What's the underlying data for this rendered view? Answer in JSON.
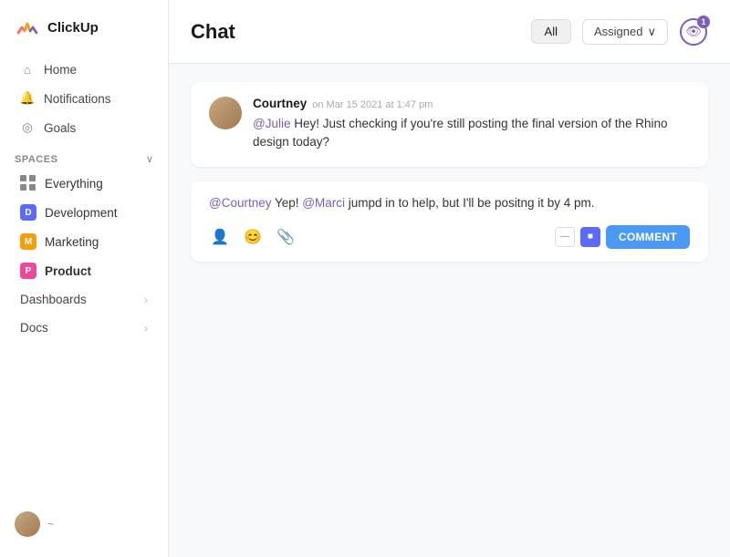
{
  "app": {
    "name": "ClickUp"
  },
  "sidebar": {
    "nav": [
      {
        "id": "home",
        "label": "Home",
        "icon": "home-icon"
      },
      {
        "id": "notifications",
        "label": "Notifications",
        "icon": "bell-icon"
      },
      {
        "id": "goals",
        "label": "Goals",
        "icon": "trophy-icon"
      }
    ],
    "spaces_label": "Spaces",
    "spaces": [
      {
        "id": "everything",
        "label": "Everything",
        "type": "grid"
      },
      {
        "id": "development",
        "label": "Development",
        "type": "badge",
        "badge_char": "D",
        "badge_class": "badge-d"
      },
      {
        "id": "marketing",
        "label": "Marketing",
        "type": "badge",
        "badge_char": "M",
        "badge_class": "badge-m"
      },
      {
        "id": "product",
        "label": "Product",
        "type": "badge",
        "badge_char": "P",
        "badge_class": "badge-p"
      }
    ],
    "sections": [
      {
        "id": "dashboards",
        "label": "Dashboards"
      },
      {
        "id": "docs",
        "label": "Docs"
      }
    ],
    "user_dot": "~"
  },
  "main": {
    "page_title": "Chat",
    "filter_all": "All",
    "filter_assigned": "Assigned",
    "eye_badge_count": "1",
    "messages": [
      {
        "id": "msg1",
        "author": "Courtney",
        "time": "on Mar 15 2021 at 1:47 pm",
        "text_parts": [
          {
            "type": "mention",
            "text": "@Julie"
          },
          {
            "type": "text",
            "text": " Hey! Just checking if you're still posting the final version of the Rhino design today?"
          }
        ]
      }
    ],
    "reply": {
      "text_parts": [
        {
          "type": "mention",
          "text": "@Courtney"
        },
        {
          "type": "text",
          "text": " Yep! "
        },
        {
          "type": "mention",
          "text": "@Marci"
        },
        {
          "type": "text",
          "text": " jumpd in to help, but I'll be positng it by 4 pm."
        }
      ]
    },
    "toolbar": {
      "comment_label": "COMMENT"
    }
  }
}
